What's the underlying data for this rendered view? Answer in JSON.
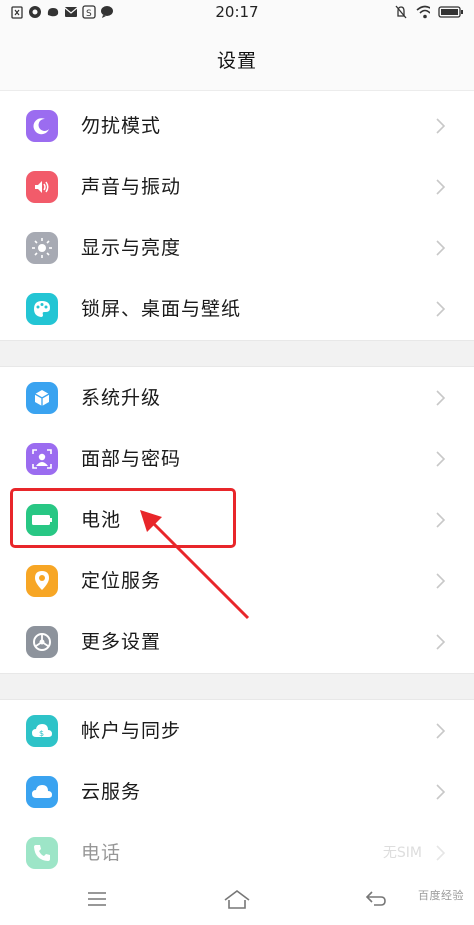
{
  "status_bar": {
    "time": "20:17",
    "left_icons": [
      "sim-card-icon",
      "notification-app-icon",
      "chat-app-icon",
      "mail-icon",
      "weibo-icon",
      "message-icon"
    ],
    "right_icons": [
      "mute-icon",
      "wifi-icon",
      "battery-icon"
    ]
  },
  "header": {
    "title": "设置"
  },
  "groups": [
    {
      "items": [
        {
          "label": "勿扰模式",
          "icon": "moon-icon",
          "color": "#9b6cf0"
        },
        {
          "label": "声音与振动",
          "icon": "speaker-icon",
          "color": "#f25b6a"
        },
        {
          "label": "显示与亮度",
          "icon": "sun-icon",
          "color": "#a7aab3"
        },
        {
          "label": "锁屏、桌面与壁纸",
          "icon": "palette-icon",
          "color": "#23c5d4"
        }
      ]
    },
    {
      "items": [
        {
          "label": "系统升级",
          "icon": "package-icon",
          "color": "#3aa3f0"
        },
        {
          "label": "面部与密码",
          "icon": "face-icon",
          "color": "#9b6cf0"
        },
        {
          "label": "电池",
          "icon": "battery-icon",
          "color": "#28c784"
        },
        {
          "label": "定位服务",
          "icon": "location-icon",
          "color": "#f7a625"
        },
        {
          "label": "更多设置",
          "icon": "gear-icon",
          "color": "#8d939c"
        }
      ]
    },
    {
      "items": [
        {
          "label": "帐户与同步",
          "icon": "account-sync-icon",
          "color": "#2ec3c8"
        },
        {
          "label": "云服务",
          "icon": "cloud-icon",
          "color": "#3aa3f0"
        },
        {
          "label": "电话",
          "icon": "phone-icon",
          "color": "#28c784",
          "value": "无SIM"
        }
      ]
    }
  ],
  "annotation": {
    "highlighted_item": "电池",
    "color": "#e8262a"
  },
  "navigation": {
    "buttons": [
      "menu-icon",
      "home-icon",
      "back-icon"
    ]
  },
  "watermark": "百度经验"
}
